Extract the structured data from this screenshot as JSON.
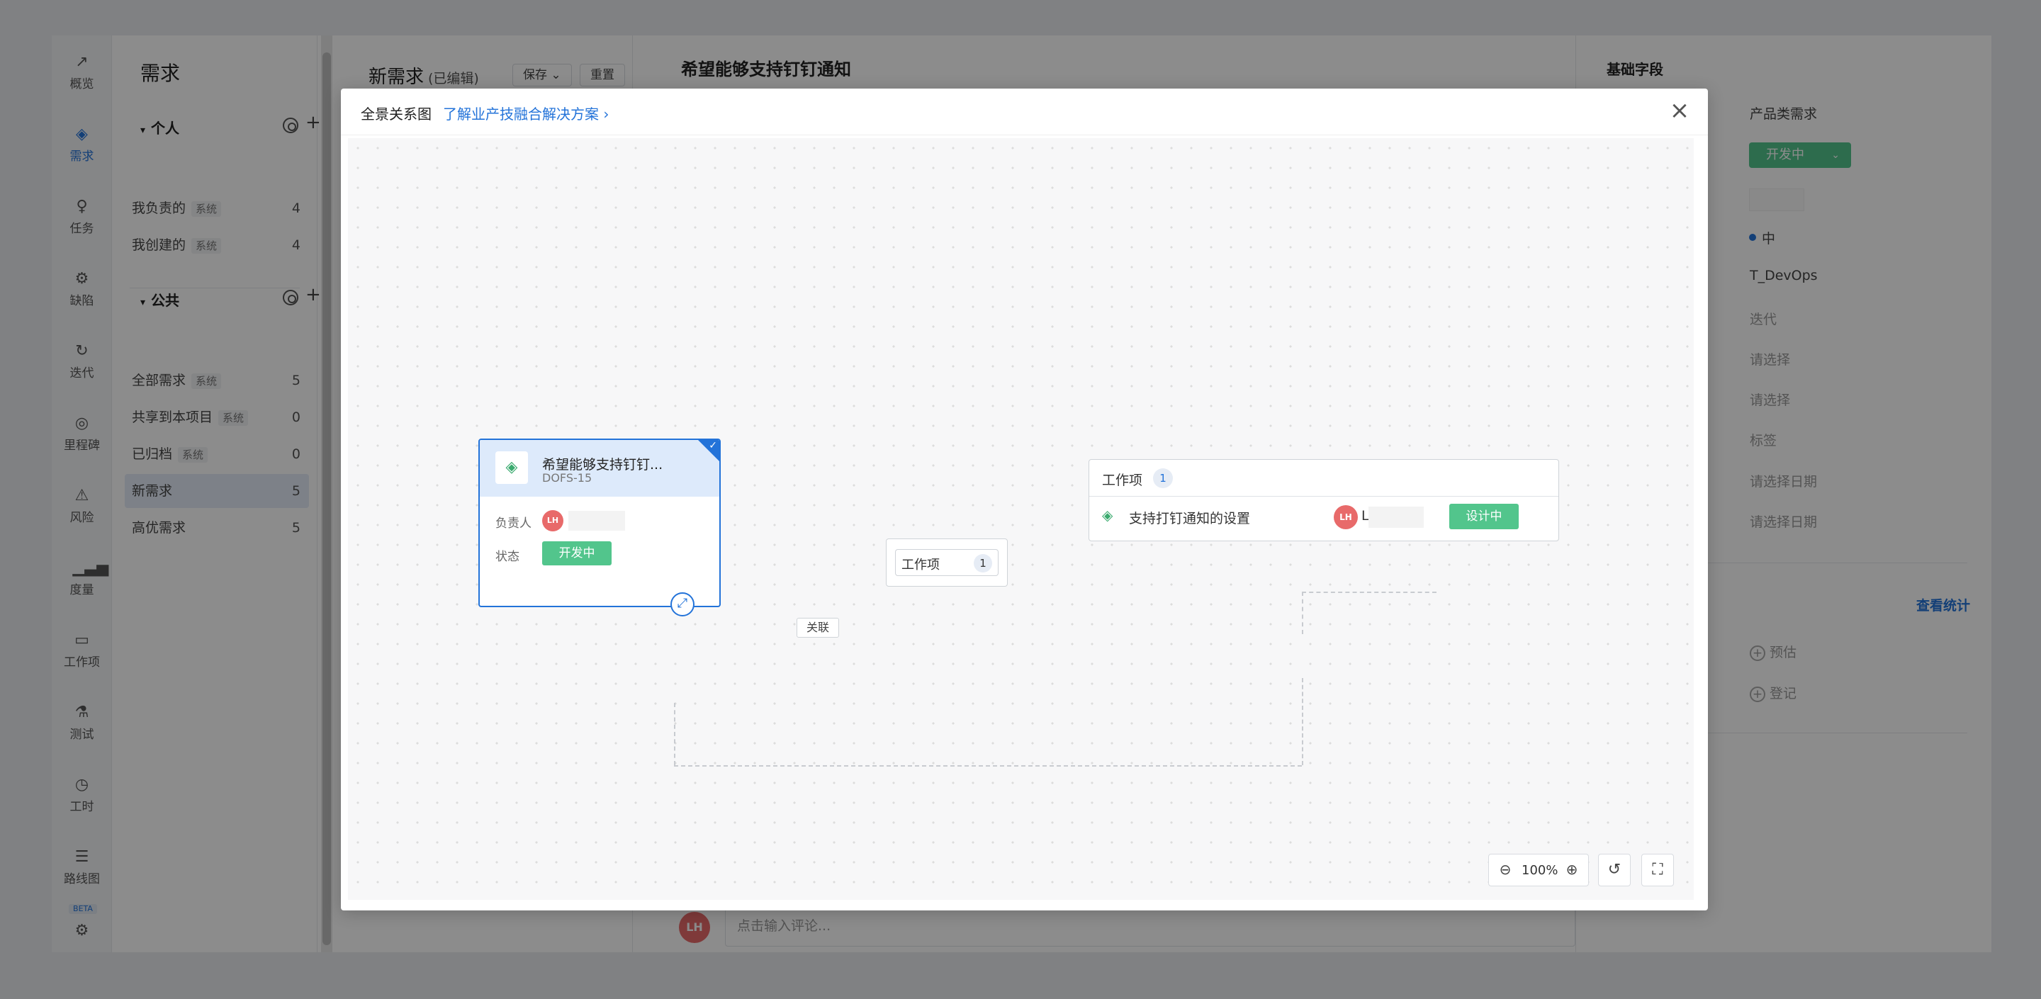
{
  "rail": {
    "items": [
      {
        "label": "概览",
        "icon": "chart-line-icon"
      },
      {
        "label": "需求",
        "icon": "layers-icon"
      },
      {
        "label": "任务",
        "icon": "bulb-icon"
      },
      {
        "label": "缺陷",
        "icon": "bug-icon"
      },
      {
        "label": "迭代",
        "icon": "cycle-icon"
      },
      {
        "label": "里程碑",
        "icon": "pin-icon"
      },
      {
        "label": "风险",
        "icon": "warning-icon"
      },
      {
        "label": "度量",
        "icon": "bar-chart-icon"
      },
      {
        "label": "工作项",
        "icon": "folder-icon"
      },
      {
        "label": "测试",
        "icon": "flask-icon"
      },
      {
        "label": "工时",
        "icon": "stopwatch-icon"
      },
      {
        "label": "路线图",
        "icon": "roadmap-icon"
      }
    ],
    "beta": "BETA"
  },
  "nav": {
    "title": "需求",
    "personal": {
      "label": "个人",
      "items": [
        {
          "label": "我负责的",
          "tag": "系统",
          "count": "4"
        },
        {
          "label": "我创建的",
          "tag": "系统",
          "count": "4"
        }
      ]
    },
    "public": {
      "label": "公共",
      "items": [
        {
          "label": "全部需求",
          "tag": "系统",
          "count": "5"
        },
        {
          "label": "共享到本项目",
          "tag": "系统",
          "count": "0"
        },
        {
          "label": "已归档",
          "tag": "系统",
          "count": "0"
        },
        {
          "label": "新需求",
          "tag": "",
          "count": "5"
        },
        {
          "label": "高优需求",
          "tag": "",
          "count": "5"
        }
      ]
    }
  },
  "list": {
    "title": "新需求",
    "subtitle": "(已编辑)",
    "save_label": "保存",
    "reset_label": "重置"
  },
  "detail": {
    "title": "希望能够支持钉钉通知",
    "comment_avatar": "LH",
    "comment_placeholder": "点击输入评论..."
  },
  "right": {
    "title": "基础字段",
    "values": [
      "产品类需求",
      "中",
      "T_DevOps",
      "迭代",
      "请选择",
      "请选择",
      "标签",
      "请选择日期",
      "请选择日期"
    ],
    "status": "开发中",
    "stats_link": "查看统计",
    "estimate": "预估",
    "register": "登记"
  },
  "modal": {
    "title": "全景关系图",
    "link": "了解业产技融合解决方案 ›",
    "close": "×",
    "source_card": {
      "title": "希望能够支持钉钉...",
      "id": "DOFS-15",
      "owner_label": "负责人",
      "owner_avatar": "LH",
      "status_label": "状态",
      "status": "开发中"
    },
    "relation_label": "关联",
    "mid_node": {
      "label": "工作项",
      "count": "1"
    },
    "work_items": {
      "title": "工作项",
      "count": "1",
      "item_name": "支持打钉通知的设置",
      "assignee_avatar": "LH",
      "assignee_initial": "L",
      "status": "设计中"
    },
    "zoom": "100%"
  },
  "colors": {
    "accent": "#2373d9",
    "status_green": "#52c58c",
    "avatar_red": "#e86a6a"
  }
}
